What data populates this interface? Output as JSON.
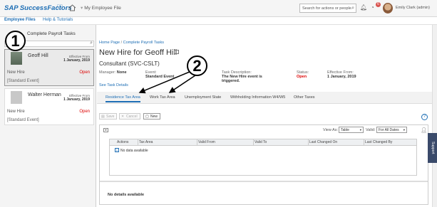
{
  "header": {
    "logo_text": "SAP SuccessFactors",
    "module_label": "My Employee File",
    "search_placeholder": "Search for actions or people",
    "notification_count": "6",
    "user_name": "Emily Clark (admin)"
  },
  "subnav": {
    "items": [
      "Employee Files",
      "Help & Tutorials"
    ]
  },
  "left_panel": {
    "title": "Complete Payroll Tasks",
    "cards": [
      {
        "name": "Geoff Hill",
        "effective_label": "Effective From",
        "effective_date": "1 January, 2019",
        "type": "New Hire",
        "status": "Open",
        "event": "[Standard Event]"
      },
      {
        "name": "Walter Herman",
        "effective_label": "Effective From",
        "effective_date": "1 January, 2019",
        "type": "New Hire",
        "status": "Open",
        "event": "[Standard Event]"
      }
    ]
  },
  "callouts": [
    "1",
    "2"
  ],
  "main": {
    "breadcrumb_home": "Home Page",
    "breadcrumb_sep": " / ",
    "breadcrumb_current": "Complete Payroll Tasks",
    "page_title": "New Hire for Geoff Hill",
    "subtitle": "Consultant (SVC-CSLT)",
    "fields": {
      "manager_label": "Manager:",
      "manager_value": "None",
      "event_label": "Event:",
      "event_value": "Standard Event",
      "task_label": "Task Description:",
      "task_value_1": "The New Hire event is",
      "task_value_2": "triggered.",
      "status_label": "Status:",
      "status_value": "Open",
      "effective_label": "Effective From:",
      "effective_value": "1 January, 2019"
    },
    "task_details_link": "See Task Details",
    "tabs": [
      "Residence Tax Area",
      "Work Tax Area",
      "Unemployment State",
      "Withholding Information W4/W5",
      "Other Taxes"
    ],
    "active_tab": 0,
    "toolbar": {
      "save": "Save",
      "cancel": "Cancel",
      "new": "New"
    },
    "help_icon_text": "?",
    "view_as_label": "View As:",
    "view_as_value": "Table",
    "valid_label": "Valid:",
    "valid_value": "For All Dates",
    "grid_columns": [
      "Actions",
      "Tax Area",
      "Valid From",
      "Valid To",
      "Last Changed On",
      "Last Changed By"
    ],
    "no_data_text": "No data available",
    "info_icon_text": "i",
    "no_details_text": "No details available"
  },
  "support_label": "Support",
  "colors": {
    "brand_blue": "#1f6fb5",
    "status_red": "#d00000"
  }
}
